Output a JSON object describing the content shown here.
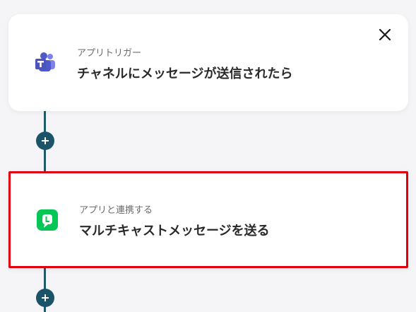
{
  "steps": [
    {
      "label": "アプリトリガー",
      "title": "チャネルにメッセージが送信されたら",
      "icon": "microsoft-teams-icon"
    },
    {
      "label": "アプリと連携する",
      "title": "マルチキャストメッセージを送る",
      "icon": "line-icon"
    }
  ],
  "icons": {
    "close": "close-icon",
    "add": "plus-icon"
  },
  "colors": {
    "connector": "#1f5a6e",
    "add_button": "#1b5468",
    "selection_border": "#e0000d",
    "teams": "#5059c9",
    "line": "#06c755"
  }
}
